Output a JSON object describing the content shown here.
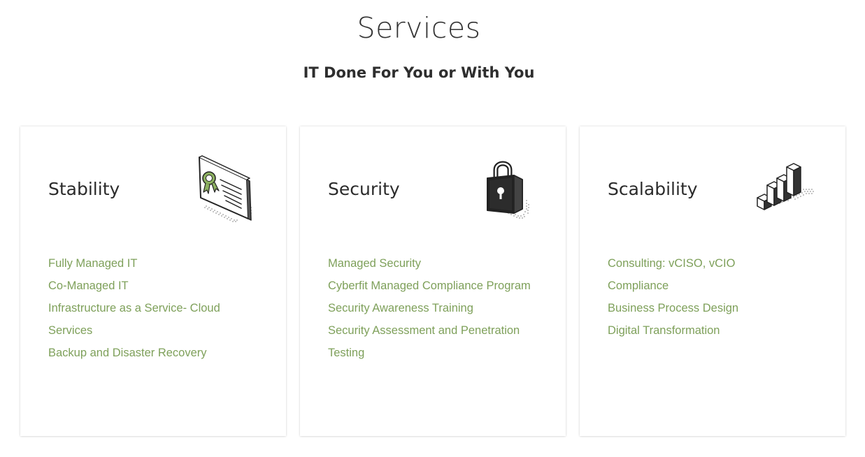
{
  "header": {
    "title": "Services",
    "subtitle": "IT Done For You or With You"
  },
  "colors": {
    "link_green": "#7ea05a",
    "icon_green": "#8cb060",
    "text_dark": "#2b2b2b"
  },
  "cards": [
    {
      "title": "Stability",
      "icon": "certificate-icon",
      "links": [
        "Fully Managed IT",
        "Co-Managed IT",
        "Infrastructure as a Service- Cloud Services",
        "Backup and Disaster Recovery"
      ]
    },
    {
      "title": "Security",
      "icon": "padlock-icon",
      "links": [
        "Managed Security",
        "Cyberfit Managed Compliance Program",
        "Security Awareness Training",
        "Security Assessment and Penetration Testing"
      ]
    },
    {
      "title": "Scalability",
      "icon": "growth-bars-icon",
      "links": [
        "Consulting: vCISO, vCIO",
        "Compliance",
        "Business Process Design",
        "Digital Transformation"
      ]
    }
  ]
}
